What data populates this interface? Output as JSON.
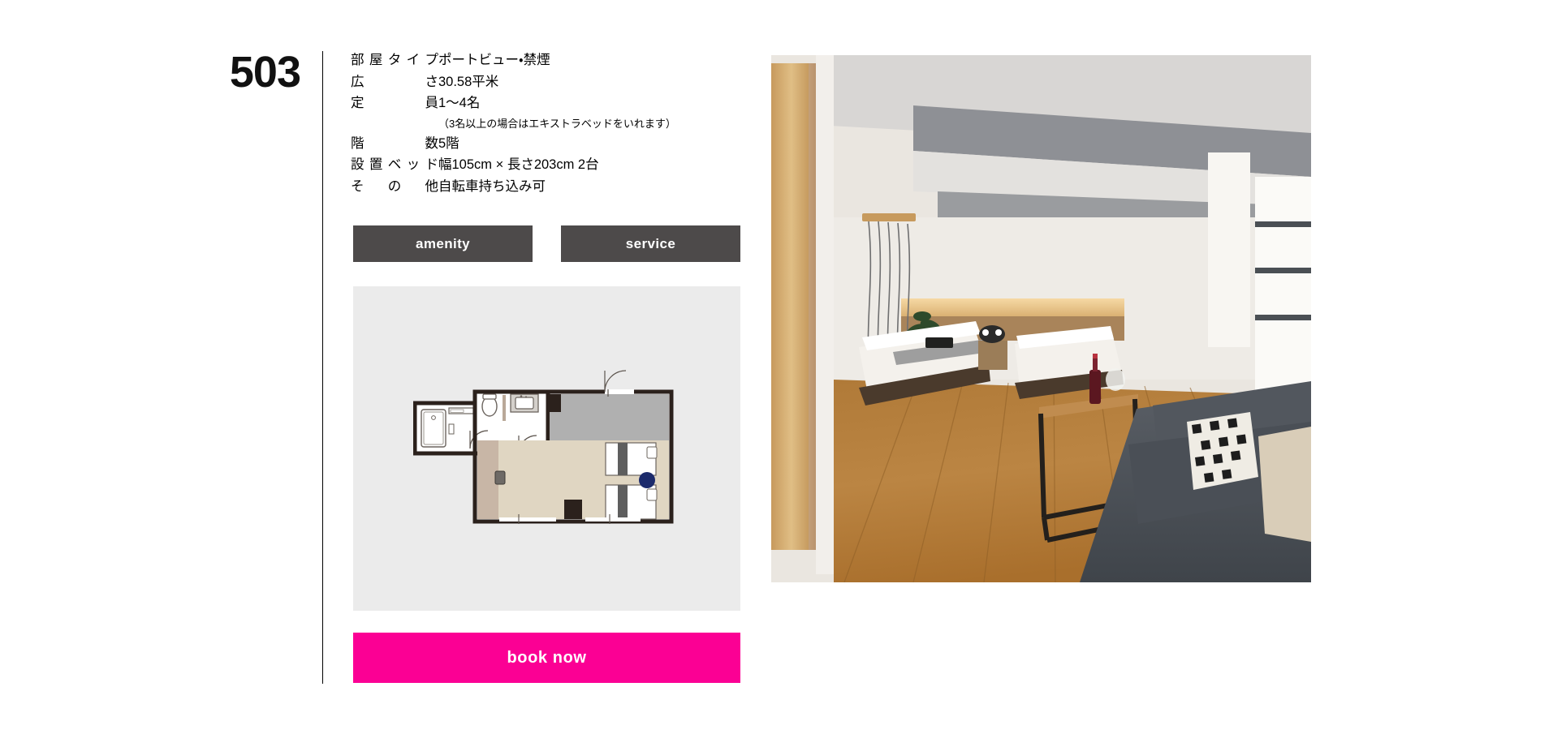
{
  "room": {
    "number": "503"
  },
  "specs": {
    "rows": [
      {
        "label": "部屋タイプ",
        "value": "ポートビュー・禁煙"
      },
      {
        "label": "広さ",
        "value": "30.58平米"
      },
      {
        "label": "定員",
        "value": "1〜4名"
      },
      {
        "label": "階数",
        "value": "5階"
      },
      {
        "label": "設置ベッド",
        "value": "幅105cm × 長さ203cm 2台"
      },
      {
        "label": "その他",
        "value": "自転車持ち込み可"
      }
    ],
    "note": "（3名以上の場合はエキストラベッドをいれます）"
  },
  "buttons": {
    "amenity_label": "amenity",
    "service_label": "service",
    "book_now_label": "book now"
  },
  "floorplan": {
    "alt": "客室間取り図",
    "colors": {
      "panel_background": "#ebebeb",
      "wall": "#2b211c",
      "living_floor": "#e0d6c2",
      "entry_floor": "#c8b6a6",
      "closet": "#b0b0b0",
      "wet_area": "#ffffff",
      "bed_accent": "#5e5e5e",
      "marker": "#1b2a6b"
    }
  },
  "photo": {
    "alt": "客室の写真（ツインベッド・ソファ・木目フローリング）",
    "colors": {
      "floor": "#b5792f",
      "wall": "#ece8e2",
      "ceiling_band": "#8e9095",
      "sofa": "#4d5157",
      "door_frame": "#d6a96a"
    }
  },
  "theme": {
    "accent_pink": "#fb0094",
    "button_dark": "#4d4a4a",
    "panel_gray": "#ebebeb",
    "text": "#000000"
  }
}
